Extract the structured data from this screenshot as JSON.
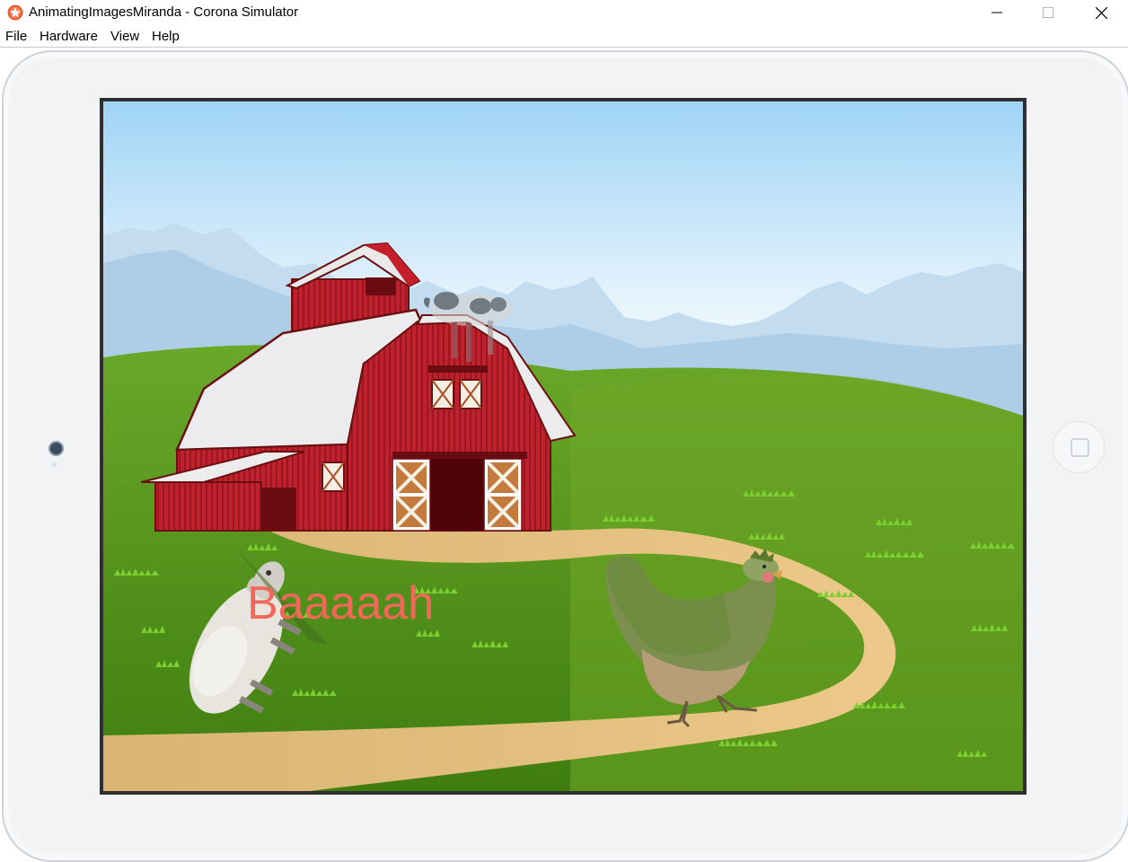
{
  "window": {
    "title": "AnimatingImagesMiranda - Corona Simulator"
  },
  "menu": {
    "items": [
      "File",
      "Hardware",
      "View",
      "Help"
    ]
  },
  "scene": {
    "sound_text": "Baaaaah",
    "icons": [
      "barn",
      "cow",
      "sheep",
      "chicken",
      "mountains",
      "hills",
      "dirt-path",
      "grass-tufts"
    ],
    "colors": {
      "sky_top": "#a9d8f5",
      "grass": "#5e9a1d",
      "barn": "#b8202a",
      "sound_text": "#f2675a",
      "path": "#e2c07c"
    }
  }
}
